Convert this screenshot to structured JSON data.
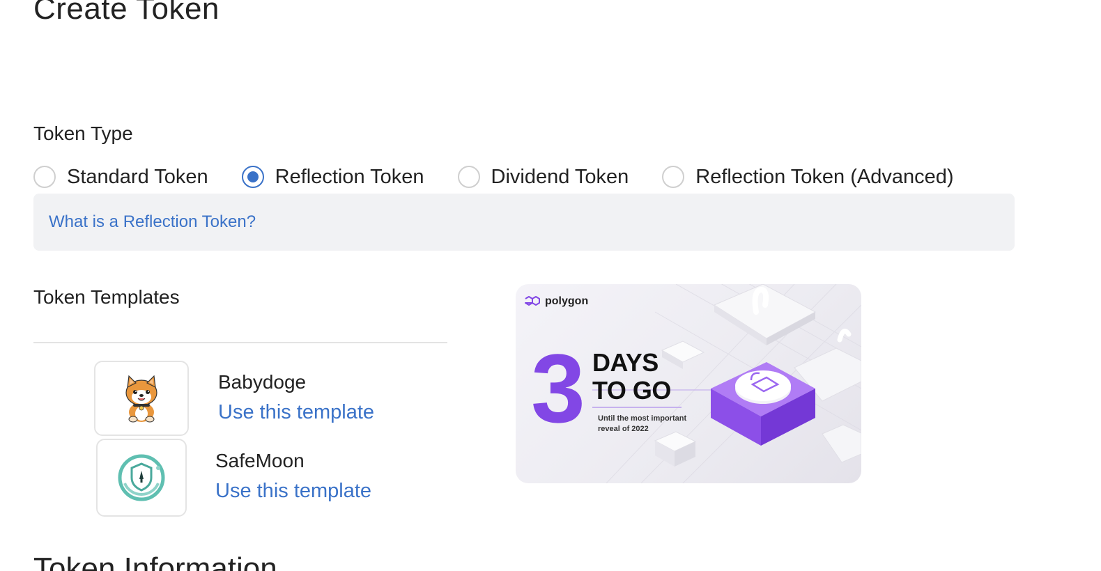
{
  "page": {
    "title": "Create Token"
  },
  "token_type": {
    "label": "Token Type",
    "options": [
      {
        "label": "Standard Token",
        "checked": false
      },
      {
        "label": "Reflection Token",
        "checked": true
      },
      {
        "label": "Dividend Token",
        "checked": false
      },
      {
        "label": "Reflection Token (Advanced)",
        "checked": false
      }
    ],
    "info_link": "What is a Reflection Token?"
  },
  "templates": {
    "label": "Token Templates",
    "items": [
      {
        "name": "Babydoge",
        "link": "Use this template",
        "icon": "babydoge-logo-icon"
      },
      {
        "name": "SafeMoon",
        "link": "Use this template",
        "icon": "safemoon-logo-icon"
      }
    ]
  },
  "promo": {
    "brand": "polygon",
    "number": "3",
    "headline_1": "DAYS",
    "headline_2": "TO GO",
    "subtext": "Until the most important reveal of 2022",
    "accent_color": "#8247e5"
  },
  "next_section": {
    "heading": "Token Information"
  },
  "colors": {
    "link": "#3a72c8",
    "info_background": "#f1f2f4",
    "radio_checked": "#3a72c8"
  }
}
